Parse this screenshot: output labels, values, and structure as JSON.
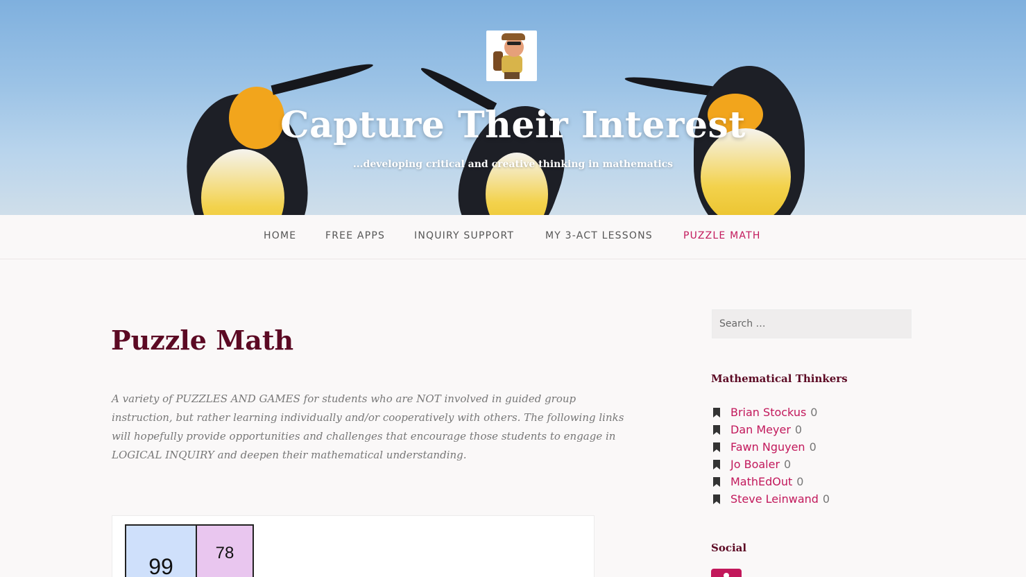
{
  "site": {
    "title": "Capture Their Interest",
    "tagline": "...developing critical and creative thinking in mathematics"
  },
  "nav": {
    "items": [
      "HOME",
      "FREE APPS",
      "INQUIRY SUPPORT",
      "MY 3-ACT LESSONS",
      "PUZZLE MATH"
    ],
    "active": "PUZZLE MATH"
  },
  "main": {
    "title": "Puzzle Math",
    "intro": "A variety of PUZZLES AND GAMES for students who are NOT involved in guided group instruction, but rather learning individually and/or cooperatively with others. The following links will hopefully provide opportunities and challenges that encourage those students to engage in LOGICAL INQUIRY and deepen their mathematical understanding.",
    "puzzle_cells": [
      "99",
      "78"
    ]
  },
  "sidebar": {
    "search_placeholder": "Search …",
    "thinkers_title": "Mathematical Thinkers",
    "thinkers": [
      {
        "name": "Brian Stockus",
        "count": "0"
      },
      {
        "name": "Dan Meyer",
        "count": "0"
      },
      {
        "name": "Fawn Nguyen",
        "count": "0"
      },
      {
        "name": "Jo Boaler",
        "count": "0"
      },
      {
        "name": "MathEdOut",
        "count": "0"
      },
      {
        "name": "Steve Leinwand",
        "count": "0"
      }
    ],
    "social_title": "Social"
  },
  "colors": {
    "accent": "#c2185b",
    "heading": "#5c0a24",
    "page_bg": "#faf8f8"
  },
  "icons": {
    "bookmark": "bookmark-icon",
    "social": "instagram-icon"
  }
}
